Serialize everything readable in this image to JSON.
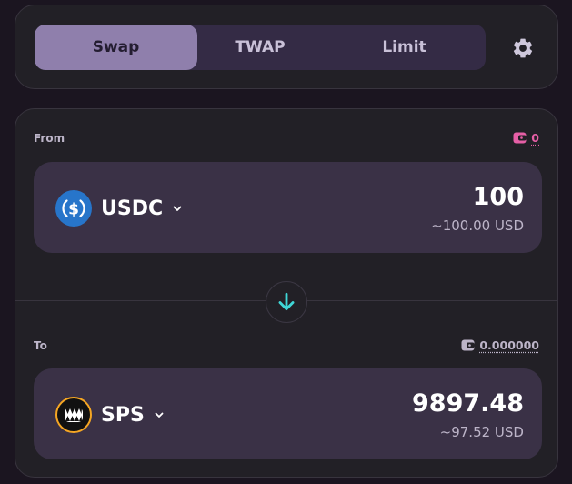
{
  "tabs": [
    {
      "label": "Swap",
      "active": true
    },
    {
      "label": "TWAP",
      "active": false
    },
    {
      "label": "Limit",
      "active": false
    }
  ],
  "settings_icon": "gear-icon",
  "from": {
    "label": "From",
    "balance": "0",
    "wallet_icon": "wallet-icon",
    "wallet_color": "#e65fa6",
    "token": "USDC",
    "token_icon": "usdc-icon",
    "amount": "100",
    "usd_value": "~100.00 USD"
  },
  "to": {
    "label": "To",
    "balance": "0.000000",
    "wallet_icon": "wallet-icon",
    "token": "SPS",
    "token_icon": "sps-icon",
    "amount": "9897.48",
    "usd_value": "~97.52 USD"
  },
  "swap_direction_icon": "arrow-down-icon",
  "colors": {
    "accent_cyan": "#3fd6d6",
    "tab_active": "#8f7fac",
    "card": "#222026",
    "token_box": "#3a3146"
  }
}
